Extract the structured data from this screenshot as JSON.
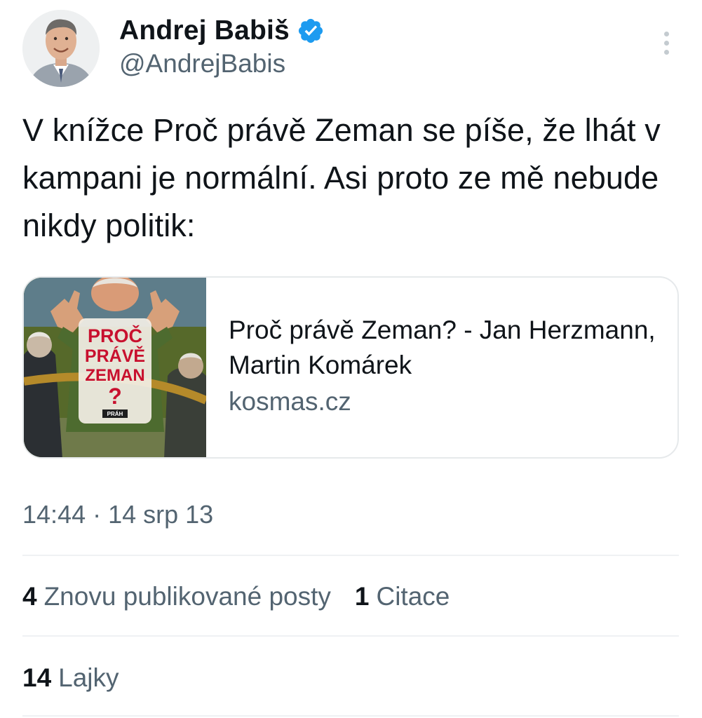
{
  "author": {
    "display_name": "Andrej Babiš",
    "handle": "@AndrejBabis",
    "verified": true,
    "avatar_icon": "profile-photo"
  },
  "tweet": {
    "text": "V knížce Proč právě Zeman se píše, že lhát v kampani je normální. Asi proto ze mě nebude nikdy politik:"
  },
  "link_card": {
    "title": "Proč právě Zeman? - Jan Herzmann, Martin Komárek",
    "domain": "kosmas.cz",
    "thumbnail": {
      "line1": "PROČ",
      "line2": "PRÁVĚ",
      "line3": "ZEMAN",
      "mark": "?",
      "publisher": "PRÁH"
    }
  },
  "timestamp": "14:44 · 14 srp 13",
  "stats": {
    "reposts": {
      "count": "4",
      "label": "Znovu publikované posty"
    },
    "quotes": {
      "count": "1",
      "label": "Citace"
    },
    "likes": {
      "count": "14",
      "label": "Lajky"
    }
  },
  "colors": {
    "text_primary": "#0f1419",
    "text_secondary": "#536471",
    "verified_blue": "#1d9bf0",
    "border": "#e6e9eb",
    "book_title_red": "#c8102e"
  }
}
